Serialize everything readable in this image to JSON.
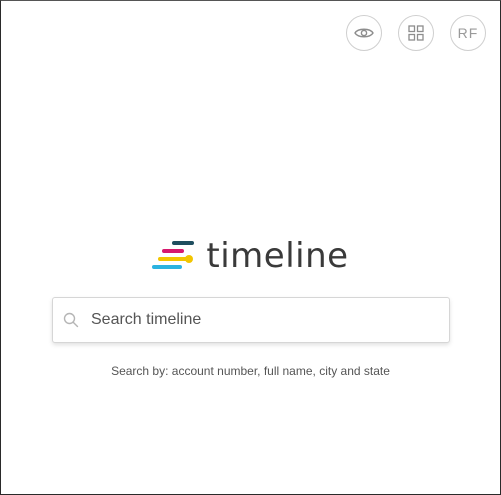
{
  "header": {
    "actions": [
      {
        "name": "preview",
        "icon": "eye-icon"
      },
      {
        "name": "apps",
        "icon": "grid-icon"
      },
      {
        "name": "user-avatar",
        "initials": "RF"
      }
    ]
  },
  "brand": {
    "wordmark": "timeline",
    "logo_icon": "timeline-logo-icon",
    "colors": [
      "#1f4e5f",
      "#d6186e",
      "#f2c500",
      "#2bb3e0"
    ]
  },
  "search": {
    "placeholder": "Search timeline",
    "value": "",
    "hint": "Search by: account number, full name, city and state"
  }
}
